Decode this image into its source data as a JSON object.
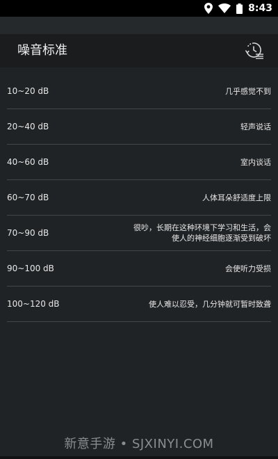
{
  "status_bar": {
    "time": "8:43",
    "icons": [
      "location-icon",
      "wifi-icon",
      "battery-icon"
    ]
  },
  "app_bar": {
    "title": "噪音标准",
    "action_icon": "history-icon"
  },
  "noise_levels": [
    {
      "range": "10~20 dB",
      "description": "几乎感觉不到"
    },
    {
      "range": "20~40 dB",
      "description": "轻声说话"
    },
    {
      "range": "40~60 dB",
      "description": "室内谈话"
    },
    {
      "range": "60~70 dB",
      "description": "人体耳朵舒适度上限"
    },
    {
      "range": "70~90 dB",
      "description": "很吵，长期在这种环境下学习和生活，会使人的神经细胞逐渐受到破坏"
    },
    {
      "range": "90~100 dB",
      "description": "会使听力受损"
    },
    {
      "range": "100~120 dB",
      "description": "使人难以忍受，几分钟就可暂时致聋"
    }
  ],
  "watermark": "新意手游 • SJXINYI.COM",
  "colors": {
    "background": "#202326",
    "app_bar": "#1a1c1e",
    "divider": "#43474b",
    "text": "#e8e8e8"
  }
}
